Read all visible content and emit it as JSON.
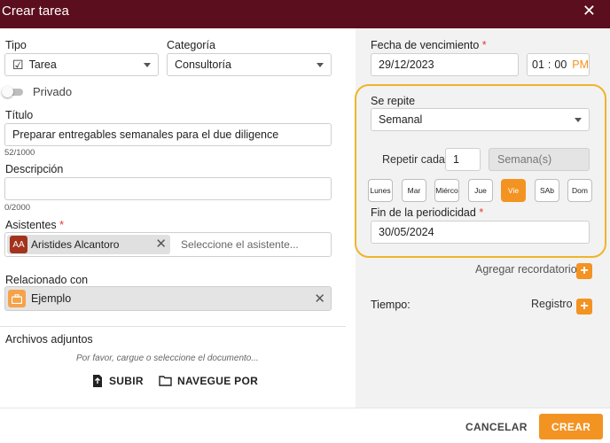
{
  "window": {
    "title": "Crear tarea"
  },
  "tipo": {
    "label": "Tipo",
    "value": "Tarea"
  },
  "categoria": {
    "label": "Categoría",
    "value": "Consultoría"
  },
  "privado": {
    "label": "Privado"
  },
  "titulo": {
    "label": "Título",
    "value": "Preparar entregables semanales para el due diligence",
    "counter": "52/1000"
  },
  "descripcion": {
    "label": "Descripción",
    "value": "",
    "counter": "0/2000"
  },
  "asistentes": {
    "label": "Asistentes",
    "required_mark": "*",
    "chip_initials": "AA",
    "chip_name": "Aristides Alcantoro",
    "placeholder": "Seleccione el asistente..."
  },
  "relacionado": {
    "label": "Relacionado con",
    "chip_name": "Ejemplo"
  },
  "archivos": {
    "label": "Archivos adjuntos",
    "hint": "Por favor, cargue o seleccione el documento...",
    "upload_label": "SUBIR",
    "browse_label": "NAVEGUE POR"
  },
  "vencimiento": {
    "label": "Fecha de vencimiento",
    "required_mark": "*",
    "date": "29/12/2023",
    "hour": "01",
    "sep": ":",
    "minute": "00",
    "ampm": "PM"
  },
  "repite": {
    "label": "Se repite",
    "value": "Semanal",
    "repetir_label": "Repetir cada",
    "repetir_value": "1",
    "unit": "Semana(s)",
    "days": [
      {
        "label": "Lunes",
        "active": false
      },
      {
        "label": "Mar",
        "active": false
      },
      {
        "label": "Miérco",
        "active": false
      },
      {
        "label": "Jue",
        "active": false
      },
      {
        "label": "Vie",
        "active": true
      },
      {
        "label": "SAb",
        "active": false
      },
      {
        "label": "Dom",
        "active": false
      }
    ]
  },
  "fin": {
    "label": "Fin de la periodicidad",
    "required_mark": "*",
    "value": "30/05/2024"
  },
  "recordatorio": {
    "label": "Agregar recordatorio"
  },
  "tiempo": {
    "label": "Tiempo:",
    "registro_label": "Registro"
  },
  "footer": {
    "cancel_label": "CANCELAR",
    "create_label": "CREAR"
  },
  "colors": {
    "header": "#5b0e1d",
    "accent": "#f39322",
    "highlight": "#f0b429",
    "required": "#e53935"
  }
}
